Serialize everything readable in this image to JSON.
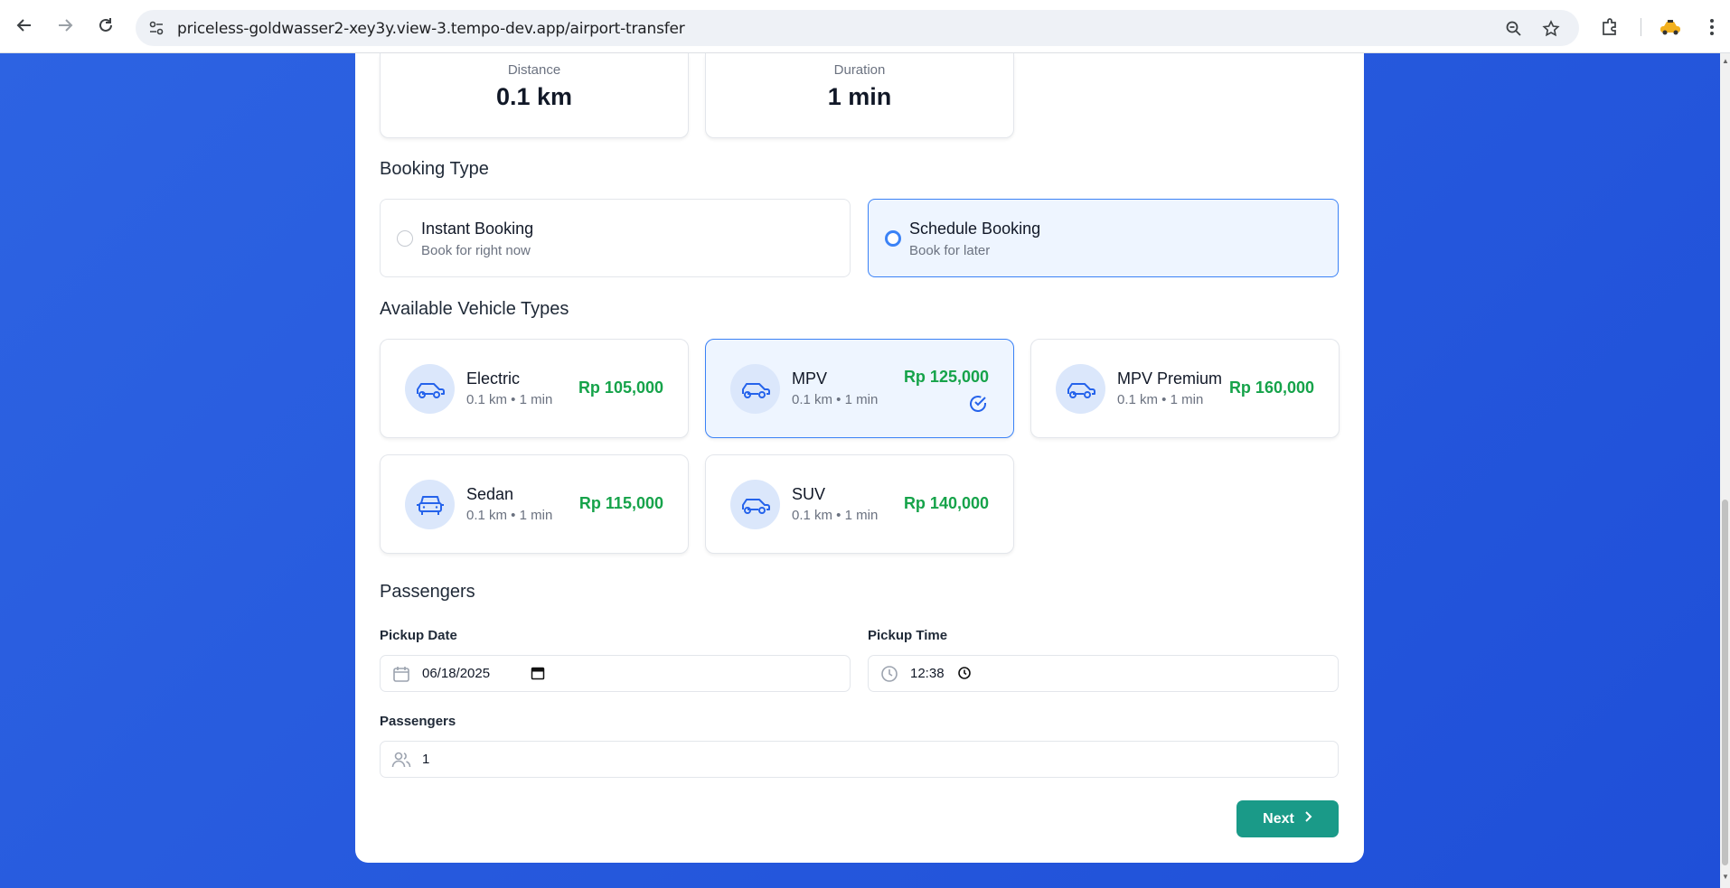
{
  "browser": {
    "url": "priceless-goldwasser2-xey3y.view-3.tempo-dev.app/airport-transfer",
    "icons": [
      "back-icon",
      "forward-icon",
      "reload-icon",
      "site-settings-icon",
      "zoom-icon",
      "bookmark-star-icon",
      "extensions-icon",
      "profile-avatar",
      "menu-icon"
    ]
  },
  "summary": {
    "distance_label": "Distance",
    "distance_value": "0.1 km",
    "duration_label": "Duration",
    "duration_value": "1 min"
  },
  "booking": {
    "title": "Booking Type",
    "options": [
      {
        "title": "Instant Booking",
        "subtitle": "Book for right now",
        "selected": false
      },
      {
        "title": "Schedule Booking",
        "subtitle": "Book for later",
        "selected": true
      }
    ]
  },
  "vehicles": {
    "title": "Available Vehicle Types",
    "items": [
      {
        "name": "Electric",
        "meta": "0.1 km • 1 min",
        "price": "Rp 105,000",
        "icon": "car-icon",
        "selected": false
      },
      {
        "name": "MPV",
        "meta": "0.1 km • 1 min",
        "price": "Rp 125,000",
        "icon": "car-icon",
        "selected": true
      },
      {
        "name": "MPV Premium",
        "meta": "0.1 km • 1 min",
        "price": "Rp 160,000",
        "icon": "car-icon",
        "selected": false
      },
      {
        "name": "Sedan",
        "meta": "0.1 km • 1 min",
        "price": "Rp 115,000",
        "icon": "car-front-icon",
        "selected": false
      },
      {
        "name": "SUV",
        "meta": "0.1 km • 1 min",
        "price": "Rp 140,000",
        "icon": "car-icon",
        "selected": false
      }
    ]
  },
  "passengers_section": {
    "title": "Passengers",
    "pickup_date_label": "Pickup Date",
    "pickup_date_value": "06/18/2025",
    "pickup_time_label": "Pickup Time",
    "pickup_time_value": "12:38",
    "passengers_label": "Passengers",
    "passengers_value": "1"
  },
  "actions": {
    "next_label": "Next"
  },
  "colors": {
    "primary": "#3b82f6",
    "price": "#16a34a",
    "next_button": "#1a9a88",
    "background": "#2a5fe0"
  }
}
